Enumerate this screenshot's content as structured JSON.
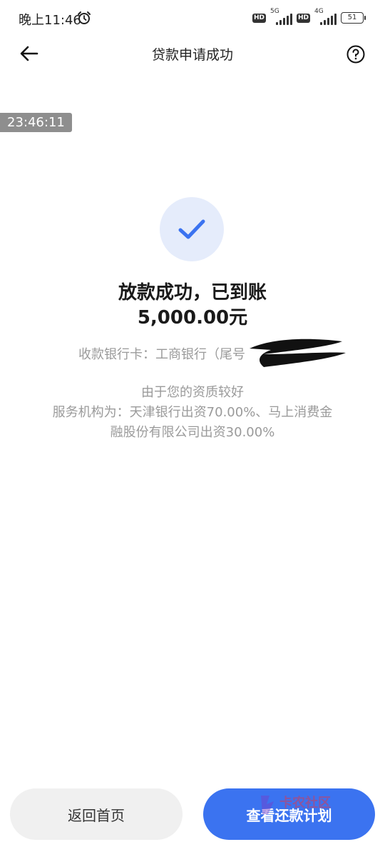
{
  "status_bar": {
    "time": "晚上11:46",
    "hd1": "HD",
    "net1": "5G",
    "hd2": "HD",
    "net2": "4G",
    "battery": "51"
  },
  "nav": {
    "title": "贷款申请成功"
  },
  "overlay": {
    "timestamp": "23:46:11"
  },
  "result": {
    "title": "放款成功，已到账",
    "amount": "5,000.00元",
    "bank_line": "收款银行卡：工商银行（尾号"
  },
  "notes": {
    "line1": "由于您的资质较好",
    "line2": "服务机构为：天津银行出资70.00%、马上消费金",
    "line3": "融股份有限公司出资30.00%"
  },
  "buttons": {
    "home_label": "返回首页",
    "plan_label": "查看还款计划"
  },
  "watermark": {
    "text": "卡农社区"
  },
  "colors": {
    "primary": "#3b73f0",
    "check_bg": "#e5ecfb",
    "secondary_text": "#9a9a9a"
  }
}
